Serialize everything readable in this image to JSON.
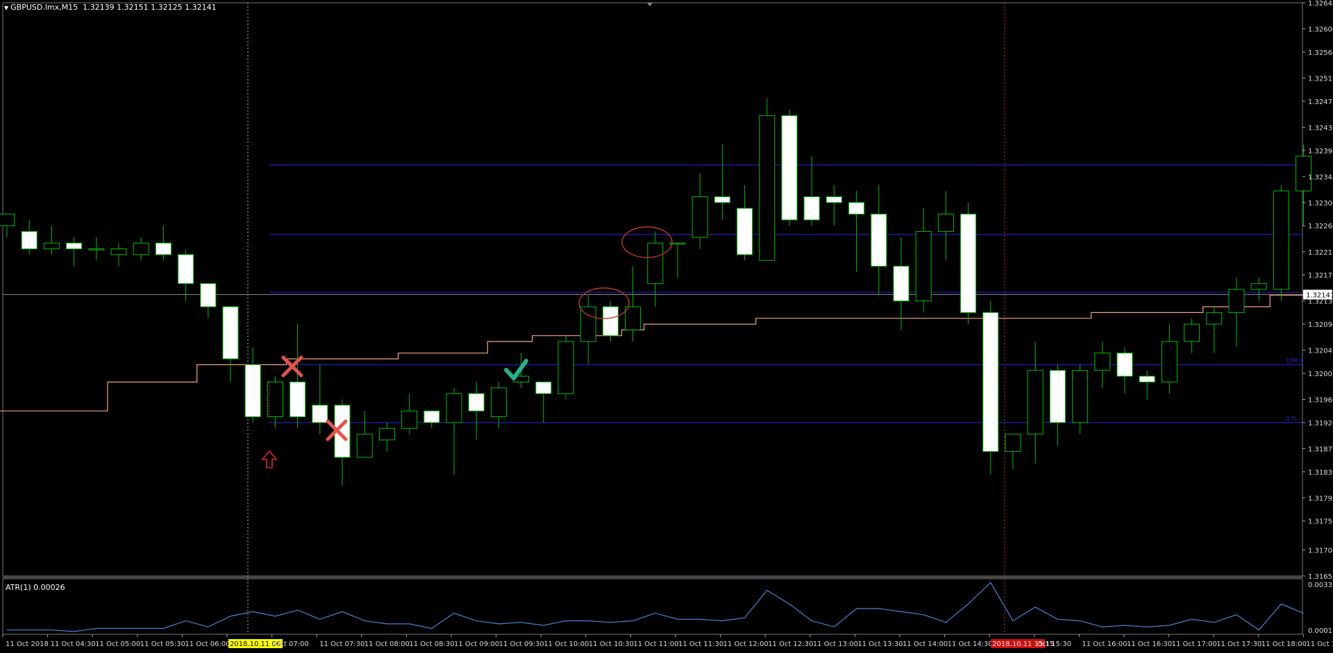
{
  "header": {
    "symbol": "GBPUSD.lmx,M15",
    "ohlc": "1.32139 1.32151 1.32125 1.32141"
  },
  "current_price_label": "1.32141",
  "atr": {
    "label": "ATR(1) 0.00026",
    "scale_top": "0.00337",
    "scale_bottom": "0.0001"
  },
  "colors": {
    "background": "#000000",
    "bull_candle": "#000000",
    "bear_candle": "#ffffff",
    "candle_outline": "#00c000",
    "ma_line": "#f4a582",
    "fib_line": "#1f1fbf",
    "atr_line": "#4a84d8",
    "cross_mark": "#e8524a",
    "check_mark": "#25b38f",
    "arrow": "#e0242a",
    "ellipse": "#c0392b"
  },
  "icons": [
    "triangle-down-icon",
    "cross-icon",
    "check-icon",
    "up-arrow-icon"
  ],
  "chart_data": {
    "type": "candlestick",
    "title": "GBPUSD.lmx,M15",
    "y_ticks": [
      "1.32645",
      "1.32600",
      "1.32560",
      "1.32515",
      "1.32475",
      "1.32430",
      "1.32390",
      "1.32345",
      "1.32300",
      "1.32260",
      "1.32215",
      "1.32175",
      "1.32130",
      "1.32090",
      "1.32045",
      "1.32005",
      "1.31960",
      "1.31920",
      "1.31875",
      "1.31835",
      "1.31790",
      "1.31750",
      "1.31700",
      "1.31655"
    ],
    "ylim": [
      1.31655,
      1.32645
    ],
    "x_ticks": [
      "11 Oct 2018",
      "11 Oct 04:30",
      "11 Oct 05:00",
      "11 Oct 05:30",
      "11 Oct 06:00",
      "2018.10.11 06:45",
      "Oct 07:00",
      "11 Oct 07:30",
      "11 Oct 08:00",
      "11 Oct 08:30",
      "11 Oct 09:00",
      "11 Oct 09:30",
      "11 Oct 10:00",
      "11 Oct 10:30",
      "11 Oct 11:00",
      "11 Oct 11:30",
      "11 Oct 12:00",
      "11 Oct 12:30",
      "11 Oct 13:00",
      "11 Oct 13:30",
      "11 Oct 14:00",
      "11 Oct 14:30",
      "2018.10.11 15:15",
      "Oct 15:30",
      "11 Oct 16:00",
      "11 Oct 16:30",
      "11 Oct 17:00",
      "11 Oct 17:30",
      "11 Oct 18:00",
      "11 Oct 18:30"
    ],
    "candles": [
      {
        "o": 1.3226,
        "h": 1.3228,
        "l": 1.3224,
        "c": 1.3228
      },
      {
        "o": 1.3225,
        "h": 1.3227,
        "l": 1.3221,
        "c": 1.3222
      },
      {
        "o": 1.3222,
        "h": 1.3226,
        "l": 1.3221,
        "c": 1.3223
      },
      {
        "o": 1.3223,
        "h": 1.3224,
        "l": 1.3219,
        "c": 1.3222
      },
      {
        "o": 1.3222,
        "h": 1.3224,
        "l": 1.322,
        "c": 1.3222
      },
      {
        "o": 1.3221,
        "h": 1.3223,
        "l": 1.3219,
        "c": 1.3222
      },
      {
        "o": 1.3221,
        "h": 1.3224,
        "l": 1.322,
        "c": 1.3223
      },
      {
        "o": 1.3223,
        "h": 1.3226,
        "l": 1.322,
        "c": 1.3221
      },
      {
        "o": 1.3221,
        "h": 1.3222,
        "l": 1.3213,
        "c": 1.3216
      },
      {
        "o": 1.3216,
        "h": 1.3216,
        "l": 1.321,
        "c": 1.3212
      },
      {
        "o": 1.3212,
        "h": 1.3212,
        "l": 1.3199,
        "c": 1.3203
      },
      {
        "o": 1.3202,
        "h": 1.3205,
        "l": 1.3192,
        "c": 1.3193
      },
      {
        "o": 1.3193,
        "h": 1.32,
        "l": 1.3191,
        "c": 1.3199
      },
      {
        "o": 1.3199,
        "h": 1.3209,
        "l": 1.3191,
        "c": 1.3193
      },
      {
        "o": 1.3195,
        "h": 1.3202,
        "l": 1.319,
        "c": 1.3192
      },
      {
        "o": 1.3195,
        "h": 1.3196,
        "l": 1.3181,
        "c": 1.3186
      },
      {
        "o": 1.3186,
        "h": 1.3194,
        "l": 1.3186,
        "c": 1.319
      },
      {
        "o": 1.3189,
        "h": 1.3192,
        "l": 1.3187,
        "c": 1.3191
      },
      {
        "o": 1.3191,
        "h": 1.3197,
        "l": 1.319,
        "c": 1.3194
      },
      {
        "o": 1.3194,
        "h": 1.3194,
        "l": 1.3191,
        "c": 1.3192
      },
      {
        "o": 1.3192,
        "h": 1.3198,
        "l": 1.3183,
        "c": 1.3197
      },
      {
        "o": 1.3197,
        "h": 1.3199,
        "l": 1.3189,
        "c": 1.3194
      },
      {
        "o": 1.3193,
        "h": 1.3199,
        "l": 1.3191,
        "c": 1.3198
      },
      {
        "o": 1.3199,
        "h": 1.3204,
        "l": 1.3198,
        "c": 1.32
      },
      {
        "o": 1.3199,
        "h": 1.3199,
        "l": 1.3192,
        "c": 1.3197
      },
      {
        "o": 1.3197,
        "h": 1.3207,
        "l": 1.3196,
        "c": 1.3206
      },
      {
        "o": 1.3206,
        "h": 1.3214,
        "l": 1.3202,
        "c": 1.3212
      },
      {
        "o": 1.3212,
        "h": 1.3213,
        "l": 1.3206,
        "c": 1.3207
      },
      {
        "o": 1.3208,
        "h": 1.3219,
        "l": 1.3206,
        "c": 1.3212
      },
      {
        "o": 1.3216,
        "h": 1.3225,
        "l": 1.3212,
        "c": 1.3223
      },
      {
        "o": 1.3223,
        "h": 1.3223,
        "l": 1.3217,
        "c": 1.3223
      },
      {
        "o": 1.3224,
        "h": 1.3235,
        "l": 1.3222,
        "c": 1.3231
      },
      {
        "o": 1.3231,
        "h": 1.324,
        "l": 1.3227,
        "c": 1.323
      },
      {
        "o": 1.3229,
        "h": 1.3233,
        "l": 1.322,
        "c": 1.3221
      },
      {
        "o": 1.322,
        "h": 1.3248,
        "l": 1.322,
        "c": 1.3245
      },
      {
        "o": 1.3245,
        "h": 1.3246,
        "l": 1.3226,
        "c": 1.3227
      },
      {
        "o": 1.3231,
        "h": 1.3238,
        "l": 1.3226,
        "c": 1.3227
      },
      {
        "o": 1.3231,
        "h": 1.3233,
        "l": 1.3226,
        "c": 1.323
      },
      {
        "o": 1.323,
        "h": 1.3232,
        "l": 1.3218,
        "c": 1.3228
      },
      {
        "o": 1.3228,
        "h": 1.3233,
        "l": 1.3214,
        "c": 1.3219
      },
      {
        "o": 1.3219,
        "h": 1.3224,
        "l": 1.3208,
        "c": 1.3213
      },
      {
        "o": 1.3213,
        "h": 1.3229,
        "l": 1.3211,
        "c": 1.3225
      },
      {
        "o": 1.3225,
        "h": 1.3232,
        "l": 1.322,
        "c": 1.3228
      },
      {
        "o": 1.3228,
        "h": 1.323,
        "l": 1.3209,
        "c": 1.3211
      },
      {
        "o": 1.3211,
        "h": 1.3213,
        "l": 1.3183,
        "c": 1.3187
      },
      {
        "o": 1.3187,
        "h": 1.319,
        "l": 1.3184,
        "c": 1.319
      },
      {
        "o": 1.319,
        "h": 1.3206,
        "l": 1.3185,
        "c": 1.3201
      },
      {
        "o": 1.3201,
        "h": 1.3202,
        "l": 1.3188,
        "c": 1.3192
      },
      {
        "o": 1.3192,
        "h": 1.3202,
        "l": 1.319,
        "c": 1.3201
      },
      {
        "o": 1.3201,
        "h": 1.3206,
        "l": 1.3198,
        "c": 1.3204
      },
      {
        "o": 1.3204,
        "h": 1.3205,
        "l": 1.3197,
        "c": 1.32
      },
      {
        "o": 1.32,
        "h": 1.3201,
        "l": 1.3196,
        "c": 1.3199
      },
      {
        "o": 1.3199,
        "h": 1.3209,
        "l": 1.3197,
        "c": 1.3206
      },
      {
        "o": 1.3206,
        "h": 1.321,
        "l": 1.3204,
        "c": 1.3209
      },
      {
        "o": 1.3209,
        "h": 1.3212,
        "l": 1.3204,
        "c": 1.3211
      },
      {
        "o": 1.3211,
        "h": 1.3217,
        "l": 1.3205,
        "c": 1.3215
      },
      {
        "o": 1.3215,
        "h": 1.3217,
        "l": 1.3213,
        "c": 1.3216
      },
      {
        "o": 1.3215,
        "h": 1.3233,
        "l": 1.3213,
        "c": 1.3232
      },
      {
        "o": 1.3232,
        "h": 1.324,
        "l": 1.3226,
        "c": 1.3238
      }
    ],
    "ma_series": [
      1.3194,
      1.3194,
      1.3194,
      1.3194,
      1.3194,
      1.3199,
      1.3199,
      1.3199,
      1.3199,
      1.3202,
      1.3202,
      1.3202,
      1.3202,
      1.3203,
      1.3203,
      1.3203,
      1.3203,
      1.3203,
      1.3204,
      1.3204,
      1.3204,
      1.3204,
      1.3206,
      1.3206,
      1.3207,
      1.3207,
      1.3207,
      1.3207,
      1.3208,
      1.3209,
      1.3209,
      1.3209,
      1.3209,
      1.3209,
      1.321,
      1.321,
      1.321,
      1.321,
      1.321,
      1.321,
      1.321,
      1.321,
      1.321,
      1.321,
      1.321,
      1.321,
      1.321,
      1.321,
      1.321,
      1.3211,
      1.3211,
      1.3211,
      1.3211,
      1.3211,
      1.3212,
      1.3212,
      1.3212,
      1.3214,
      1.3214
    ],
    "fib_levels": [
      {
        "label": "0.0",
        "price": 1.3192
      },
      {
        "label": "100.0",
        "price": 1.3202
      },
      {
        "label": "",
        "price": 1.32145
      },
      {
        "label": "",
        "price": 1.32245
      },
      {
        "label": "",
        "price": 1.32365
      }
    ],
    "atr_values": [
      0.0002,
      0.0002,
      0.0002,
      0.0001,
      0.0003,
      0.0003,
      0.0003,
      0.0003,
      0.0008,
      0.0004,
      0.0011,
      0.0014,
      0.0011,
      0.0015,
      0.0009,
      0.0014,
      0.0008,
      0.0006,
      0.0006,
      0.0003,
      0.0013,
      0.0008,
      0.0006,
      0.0007,
      0.0005,
      0.0008,
      0.0008,
      0.0007,
      0.0008,
      0.0013,
      0.0009,
      0.0009,
      0.0008,
      0.001,
      0.0028,
      0.0019,
      0.0008,
      0.0004,
      0.0016,
      0.0016,
      0.0014,
      0.0012,
      0.0007,
      0.0019,
      0.0033,
      0.0008,
      0.0017,
      0.0009,
      0.0008,
      0.0004,
      0.0005,
      0.0004,
      0.0005,
      0.0009,
      0.0007,
      0.0012,
      0.0002,
      0.0019,
      0.0013
    ]
  }
}
